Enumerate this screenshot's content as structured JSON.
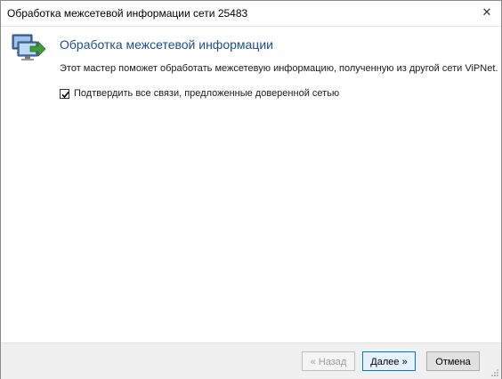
{
  "window": {
    "title": "Обработка межсетевой информации сети 25483",
    "close_glyph": "✕"
  },
  "wizard": {
    "icon": "network-transfer-icon",
    "heading": "Обработка межсетевой информации",
    "description": "Этот мастер поможет обработать межсетевую информацию, полученную из другой сети ViPNet.",
    "confirm_checkbox": {
      "label": "Подтвердить все связи, предложенные доверенной сетью",
      "checked": true
    }
  },
  "footer": {
    "back_label": "« Назад",
    "next_label": "Далее »",
    "cancel_label": "Отмена"
  },
  "colors": {
    "heading": "#1f4e8c",
    "accent": "#0078d7"
  }
}
